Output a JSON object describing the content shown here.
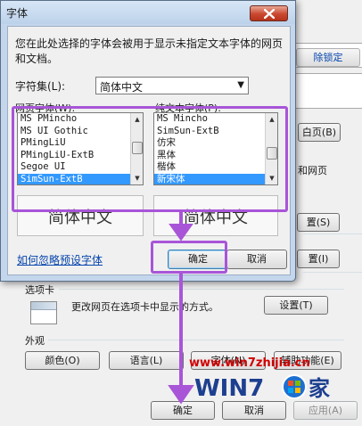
{
  "background_window": {
    "unlock_label": "除锁定",
    "blank_button": "白页(B)",
    "web_text": "和网页",
    "b1": "置(S)",
    "b2": "置(I)",
    "tabs_group_label": "选项卡",
    "tabs_description": "更改网页在选项卡中显示的方式。",
    "tabs_settings_button": "设置(T)",
    "appearance_group_label": "外观",
    "colors_button": "颜色(O)",
    "languages_button": "语言(L)",
    "fonts_button": "字体(N)",
    "accessibility_button": "辅助功能(E)",
    "ok_button": "确定",
    "cancel_button": "取消",
    "apply_button": "应用(A)"
  },
  "watermark": {
    "url": "www.win7zhijia.cn",
    "logo_text": "WIN7",
    "logo_suffix": "家"
  },
  "dialog": {
    "title": "字体",
    "description": "您在此处选择的字体会被用于显示未指定文本字体的网页和文档。",
    "charset_label": "字符集(L):",
    "charset_value": "简体中文",
    "web_font_label": "网页字体(W):",
    "plain_font_label": "纯文本字体(P):",
    "web_fonts": [
      "MS PMincho",
      "MS UI Gothic",
      "PMingLiU",
      "PMingLiU-ExtB",
      "Segoe UI",
      "SimSun-ExtB"
    ],
    "web_selected": "SimSun-ExtB",
    "plain_fonts": [
      "MS Mincho",
      "SimSun-ExtB",
      "仿宋",
      "黑体",
      "楷体",
      "新宋体"
    ],
    "plain_selected": "新宋体",
    "web_preview": "简体中文",
    "plain_preview": "简体中文",
    "ignore_link": "如何忽略预设字体",
    "ok_button": "确定",
    "cancel_button": "取消"
  },
  "colors": {
    "highlight": "#a855d8",
    "selection": "#3399ff",
    "close_red": "#c9482f",
    "watermark_red": "#d10000"
  }
}
